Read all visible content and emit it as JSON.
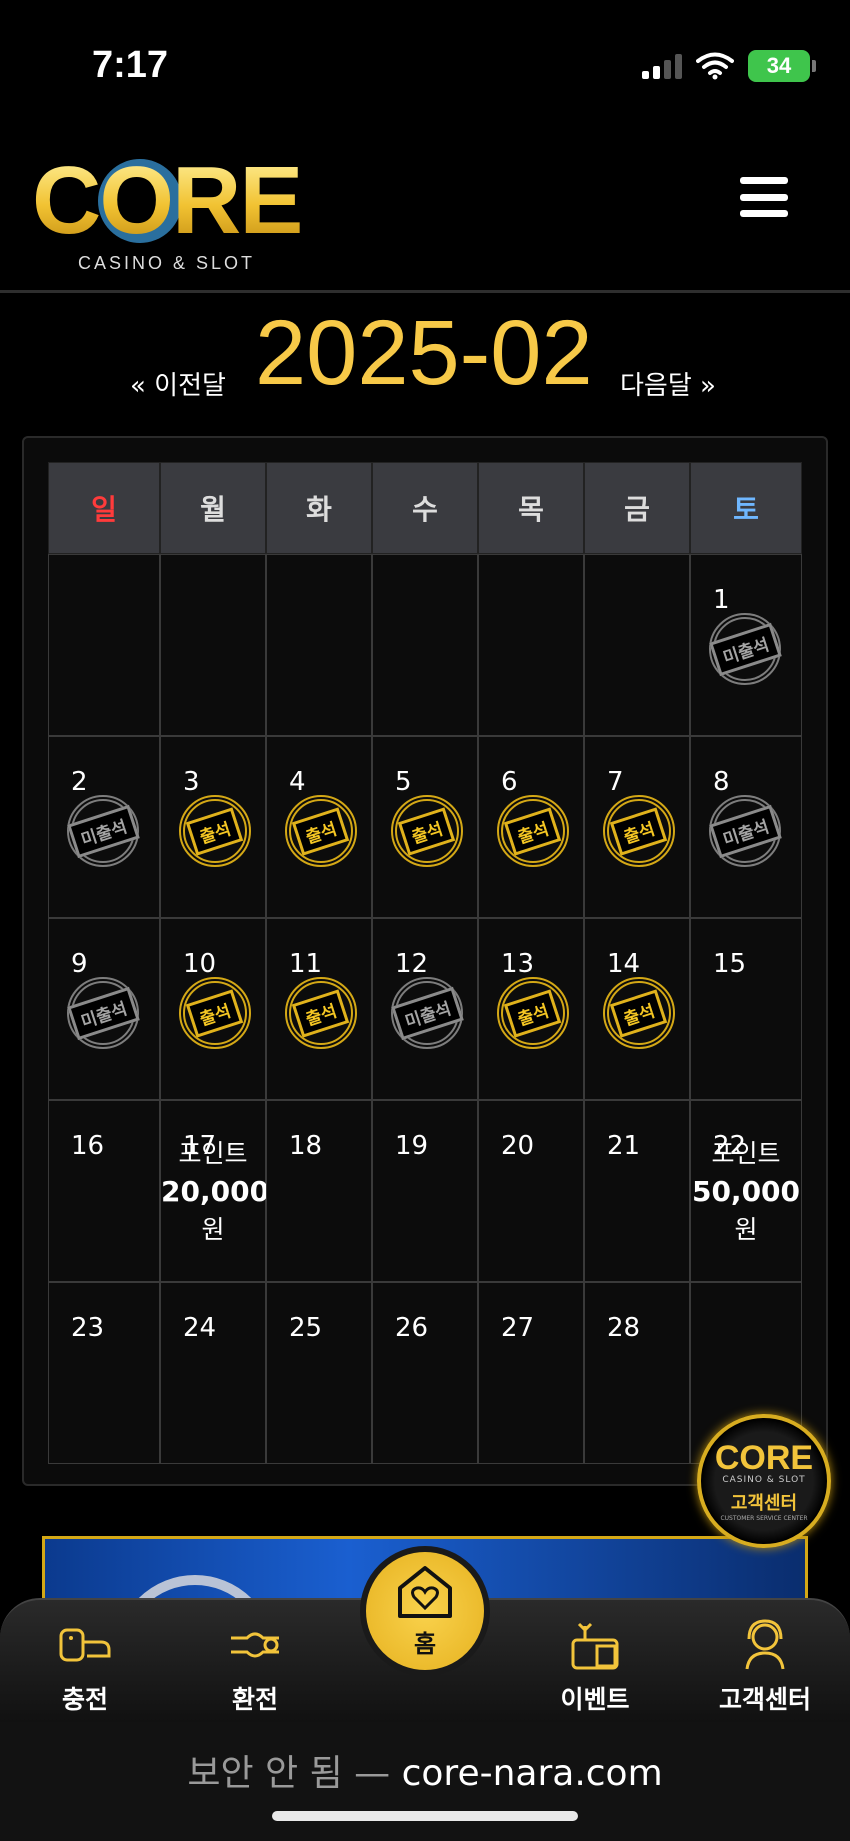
{
  "status_bar": {
    "time": "7:17",
    "battery": "34"
  },
  "header": {
    "logo_text": "CORE",
    "logo_sub": "CASINO & SLOT",
    "menu_icon": "hamburger-menu-icon"
  },
  "month_nav": {
    "prev": "« 이전달",
    "title": "2025-02",
    "next": "다음달 »"
  },
  "calendar": {
    "weekdays": [
      "일",
      "월",
      "화",
      "수",
      "목",
      "금",
      "토"
    ],
    "colors": {
      "sunday": "#ff3b3b",
      "saturday": "#6fb7ff",
      "attended": "#f4c623",
      "missed": "#a4a4a4"
    },
    "stamp_labels": {
      "attended": "출석",
      "missed": "미출석"
    },
    "weeks": [
      [
        {
          "day": ""
        },
        {
          "day": ""
        },
        {
          "day": ""
        },
        {
          "day": ""
        },
        {
          "day": ""
        },
        {
          "day": ""
        },
        {
          "day": "1",
          "status": "missed"
        }
      ],
      [
        {
          "day": "2",
          "status": "missed"
        },
        {
          "day": "3",
          "status": "attended"
        },
        {
          "day": "4",
          "status": "attended"
        },
        {
          "day": "5",
          "status": "attended"
        },
        {
          "day": "6",
          "status": "attended"
        },
        {
          "day": "7",
          "status": "attended"
        },
        {
          "day": "8",
          "status": "missed"
        }
      ],
      [
        {
          "day": "9",
          "status": "missed"
        },
        {
          "day": "10",
          "status": "attended"
        },
        {
          "day": "11",
          "status": "attended"
        },
        {
          "day": "12",
          "status": "missed"
        },
        {
          "day": "13",
          "status": "attended"
        },
        {
          "day": "14",
          "status": "attended"
        },
        {
          "day": "15"
        }
      ],
      [
        {
          "day": "16"
        },
        {
          "day": "17",
          "reward": {
            "label": "포인트",
            "amount": "20,000",
            "unit": "원"
          }
        },
        {
          "day": "18"
        },
        {
          "day": "19"
        },
        {
          "day": "20"
        },
        {
          "day": "21"
        },
        {
          "day": "22",
          "reward": {
            "label": "포인트",
            "amount": "50,000",
            "unit": "원"
          }
        }
      ],
      [
        {
          "day": "23"
        },
        {
          "day": "24"
        },
        {
          "day": "25"
        },
        {
          "day": "26"
        },
        {
          "day": "27"
        },
        {
          "day": "28"
        },
        {
          "day": ""
        }
      ]
    ]
  },
  "cs_float": {
    "logo": "CORE",
    "sub": "CASINO & SLOT",
    "label": "고객센터",
    "tiny": "CUSTOMER SERVICE CENTER"
  },
  "bottom_nav": {
    "items": [
      {
        "label": "충전",
        "icon": "charge-icon"
      },
      {
        "label": "환전",
        "icon": "exchange-icon"
      },
      {
        "label": "홈",
        "icon": "home-heart-icon"
      },
      {
        "label": "이벤트",
        "icon": "gift-icon"
      },
      {
        "label": "고객센터",
        "icon": "support-agent-icon"
      }
    ]
  },
  "url_bar": {
    "insecure_label": "보안 안 됨 — ",
    "domain": "core-nara.com"
  }
}
